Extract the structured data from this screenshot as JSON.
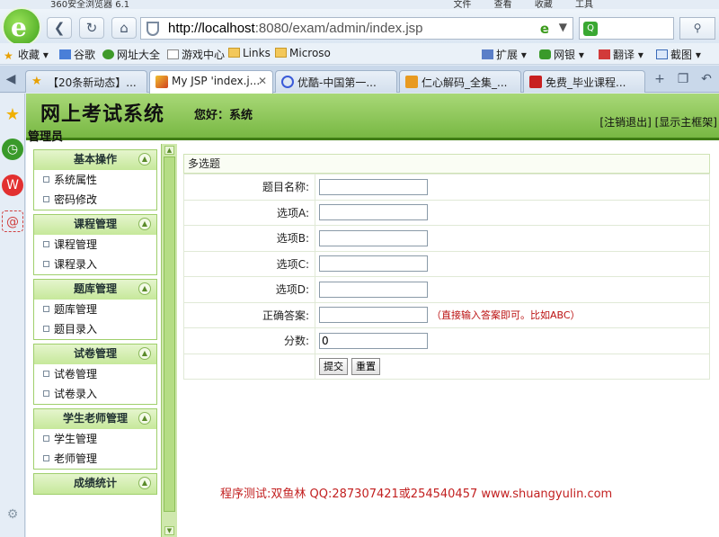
{
  "browser": {
    "app_title": "360安全浏览器 6.1",
    "menu": [
      "文件",
      "查看",
      "收藏",
      "工具"
    ],
    "url_host": "http://localhost",
    "url_rest": ":8080/exam/admin/index.jsp",
    "bookmarks": [
      "收藏",
      "谷歌",
      "网址大全",
      "游戏中心",
      "Links",
      "Microso",
      "扩展",
      "网银",
      "翻译",
      "截图"
    ],
    "tabs": [
      {
        "label": "【20条新动态】..."
      },
      {
        "label": "My JSP 'index.j..."
      },
      {
        "label": "优酷-中国第一..."
      },
      {
        "label": "仁心解码_全集_..."
      },
      {
        "label": "免费_毕业课程..."
      }
    ]
  },
  "header": {
    "system_title": "网上考试系统",
    "greeting": "您好：系统",
    "role": "管理员",
    "logout_link": "[注销退出]",
    "frame_link": "[显示主框架]"
  },
  "menu": [
    {
      "title": "基本操作",
      "items": [
        "系统属性",
        "密码修改"
      ]
    },
    {
      "title": "课程管理",
      "items": [
        "课程管理",
        "课程录入"
      ]
    },
    {
      "title": "题库管理",
      "items": [
        "题库管理",
        "题目录入"
      ]
    },
    {
      "title": "试卷管理",
      "items": [
        "试卷管理",
        "试卷录入"
      ]
    },
    {
      "title": "学生老师管理",
      "items": [
        "学生管理",
        "老师管理"
      ]
    },
    {
      "title": "成绩统计",
      "items": []
    }
  ],
  "form": {
    "caption": "多选题",
    "fields": [
      {
        "label": "题目名称:",
        "value": ""
      },
      {
        "label": "选项A:",
        "value": ""
      },
      {
        "label": "选项B:",
        "value": ""
      },
      {
        "label": "选项C:",
        "value": ""
      },
      {
        "label": "选项D:",
        "value": ""
      },
      {
        "label": "正确答案:",
        "value": "",
        "hint": "（直接输入答案即可。比如ABC）"
      },
      {
        "label": "分数:",
        "value": "0"
      }
    ],
    "submit_label": "提交",
    "reset_label": "重置"
  },
  "footer": "程序测试:双鱼林 QQ:287307421或254540457 www.shuangyulin.com"
}
